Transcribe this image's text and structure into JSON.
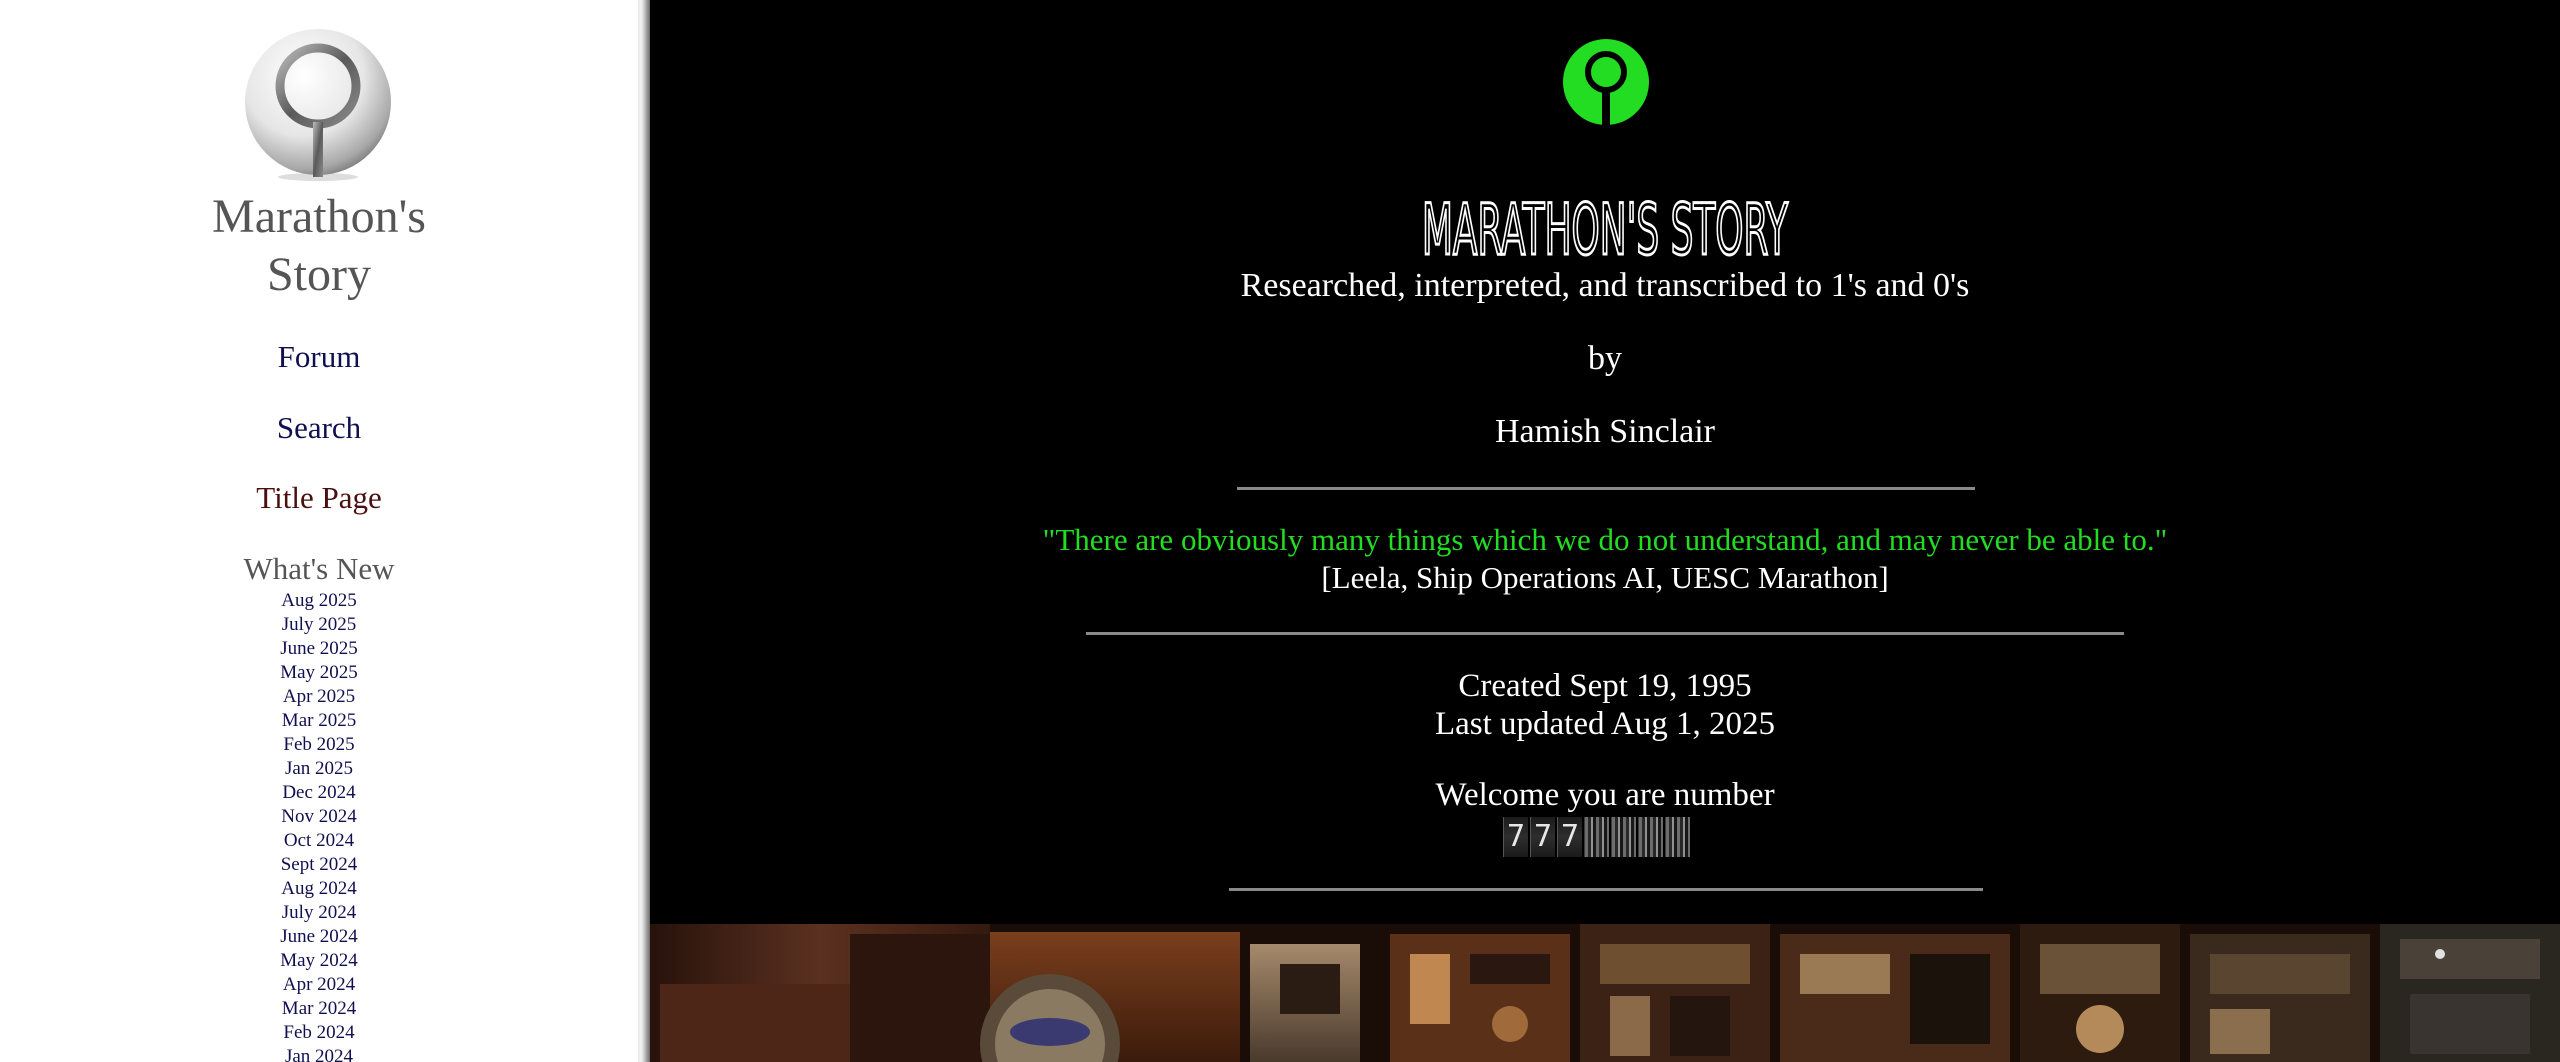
{
  "nav": {
    "site_title_line1": "Marathon's",
    "site_title_line2": "Story",
    "forum": "Forum",
    "search": "Search",
    "title_page": "Title Page",
    "whats_new": "What's New",
    "months": [
      "Aug 2025",
      "July 2025",
      "June 2025",
      "May 2025",
      "Apr 2025",
      "Mar 2025",
      "Feb 2025",
      "Jan 2025",
      "Dec 2024",
      "Nov 2024",
      "Oct 2024",
      "Sept 2024",
      "Aug 2024",
      "July 2024",
      "June 2024",
      "May 2024",
      "Apr 2024",
      "Mar 2024",
      "Feb 2024",
      "Jan 2024"
    ]
  },
  "main": {
    "banner_text": "MARATHON'S STORY",
    "subtitle": "Researched, interpreted, and transcribed to 1's and 0's",
    "by": "by",
    "author": "Hamish Sinclair",
    "quote": "\"There are obviously many things which we do not understand, and may never be able to.\"",
    "attribution": "[Leela, Ship Operations AI, UESC Marathon]",
    "created": "Created Sept 19, 1995",
    "updated": "Last updated Aug 1, 2025",
    "welcome": "Welcome you are number",
    "counter_visible_digits": [
      "7",
      "7",
      "7"
    ]
  },
  "colors": {
    "quote_green": "#22dd22",
    "logo_green": "#22dd22",
    "nav_link": "#101050",
    "title_page_link": "#4a1010"
  },
  "icons": {
    "nav_logo": "marathon-logo-icon",
    "main_logo": "marathon-logo-green-icon"
  }
}
